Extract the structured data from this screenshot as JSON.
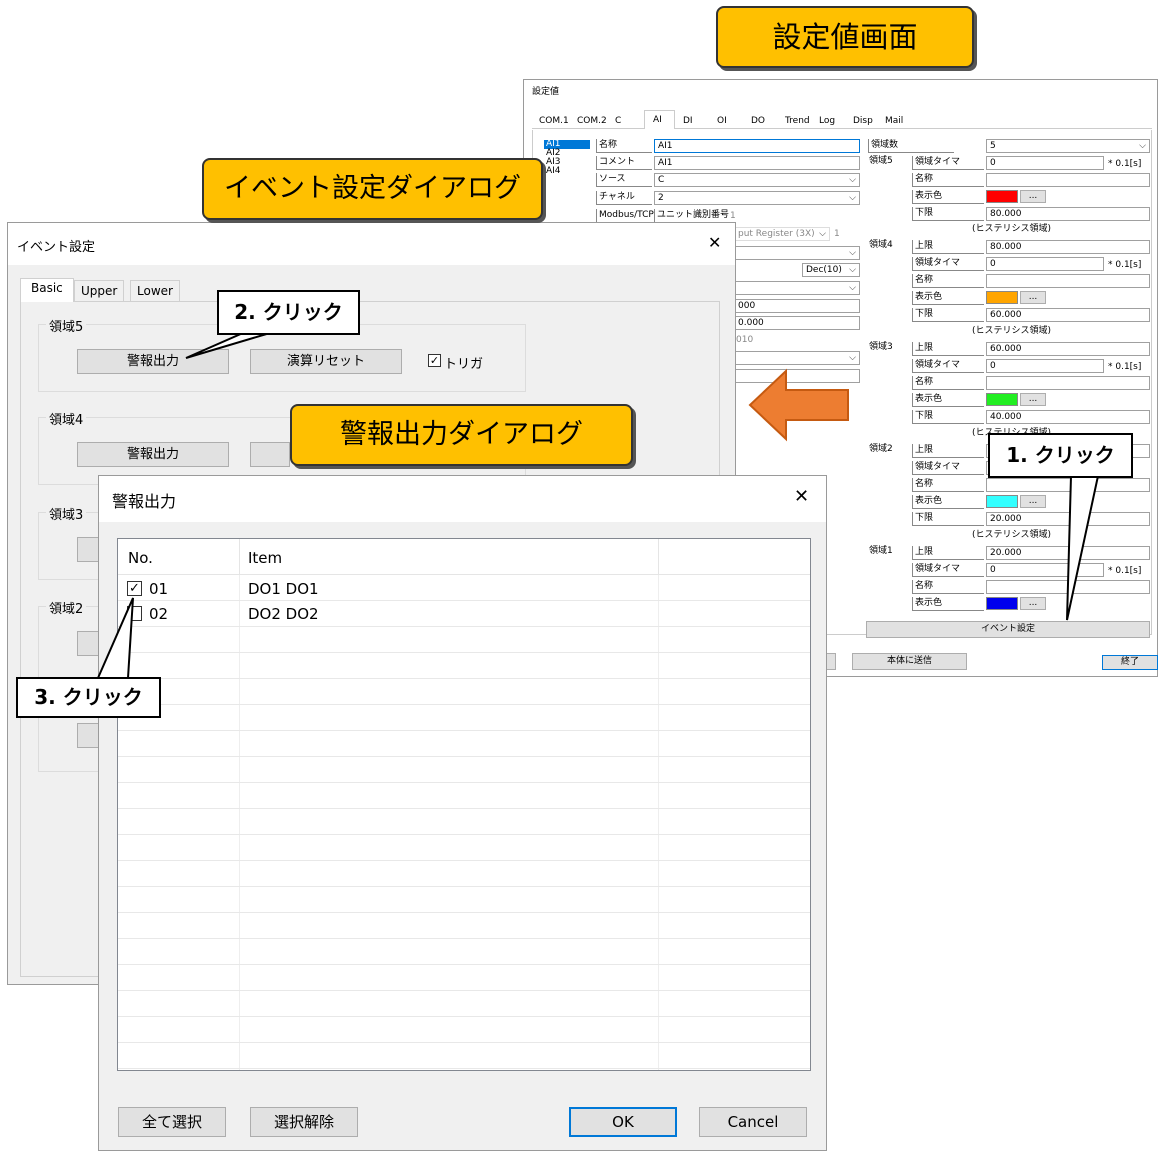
{
  "callouts": {
    "settings_screen": "設定値画面",
    "event_dialog": "イベント設定ダイアログ",
    "alarm_dialog": "警報出力ダイアログ",
    "step1": "1. クリック",
    "step2": "2. クリック",
    "step3": "3. クリック"
  },
  "settings": {
    "title": "設定値",
    "tabs": [
      "COM.1",
      "COM.2",
      "C",
      "AI",
      "DI",
      "OI",
      "DO",
      "Trend",
      "Log",
      "Disp",
      "Mail"
    ],
    "channels": [
      "AI1",
      "AI2",
      "AI3",
      "AI4"
    ],
    "fields": {
      "name_label": "名称",
      "name_value": "AI1",
      "comment_label": "コメント",
      "comment_value": "AI1",
      "source_label": "ソース",
      "source_value": "C",
      "channel_label": "チャネル",
      "channel_value": "2",
      "modbus_label": "Modbus/TCP",
      "unit_label": "ユニット識別番号",
      "unit_value": "1",
      "register_value": "put Register (3X)",
      "register_num": "1",
      "format_value": "Dec(10)",
      "val_a": "000",
      "val_b": "0.000",
      "val_c": "010"
    },
    "zone_count_label": "領域数",
    "zone_count_value": "5",
    "zones": {
      "zone5": {
        "label": "領域5",
        "timer_label": "領域タイマ",
        "timer_value": "0",
        "unit": "* 0.1[s]",
        "name_label": "名称",
        "color_label": "表示色",
        "color": "#ff0000",
        "lower_label": "下限",
        "lower_value": "80.000"
      },
      "hys1": "(ヒステリシス領域)",
      "zone4": {
        "label": "領域4",
        "upper_label": "上限",
        "upper_value": "80.000",
        "timer_label": "領域タイマ",
        "timer_value": "0",
        "unit": "* 0.1[s]",
        "name_label": "名称",
        "color_label": "表示色",
        "color": "#ffa500",
        "lower_label": "下限",
        "lower_value": "60.000"
      },
      "hys2": "(ヒステリシス領域)",
      "zone3": {
        "label": "領域3",
        "upper_label": "上限",
        "upper_value": "60.000",
        "timer_label": "領域タイマ",
        "timer_value": "0",
        "unit": "* 0.1[s]",
        "name_label": "名称",
        "color_label": "表示色",
        "color": "#22ee22",
        "lower_label": "下限",
        "lower_value": "40.000"
      },
      "hys3": "(ヒステリシス領域)",
      "zone2": {
        "label": "領域2",
        "upper_label": "上限",
        "timer_label": "領域タイマ",
        "name_label": "名称",
        "color_label": "表示色",
        "color": "#33ffff",
        "lower_label": "下限",
        "lower_value": "20.000"
      },
      "hys4": "(ヒステリシス領域)",
      "zone1": {
        "label": "領域1",
        "upper_label": "上限",
        "upper_value": "20.000",
        "timer_label": "領域タイマ",
        "timer_value": "0",
        "unit": "* 0.1[s]",
        "name_label": "名称",
        "color_label": "表示色",
        "color": "#0000ee"
      }
    },
    "ellipsis": "...",
    "event_button": "イベント設定",
    "send_button": "本体に送信",
    "exit_button": "終了"
  },
  "event_dialog": {
    "title": "イベント設定",
    "close": "✕",
    "tabs": [
      "Basic",
      "Upper",
      "Lower"
    ],
    "zones": [
      "領域5",
      "領域4",
      "領域3",
      "領域2"
    ],
    "alarm_button": "警報出力",
    "reset_button": "演算リセット",
    "trigger_label": "トリガ"
  },
  "alarm_dialog": {
    "title": "警報出力",
    "close": "✕",
    "columns": [
      "No.",
      "Item"
    ],
    "rows": [
      {
        "no": "01",
        "item": "DO1 DO1",
        "checked": true
      },
      {
        "no": "02",
        "item": "DO2 DO2",
        "checked": false
      }
    ],
    "select_all": "全て選択",
    "deselect": "選択解除",
    "ok": "OK",
    "cancel": "Cancel"
  }
}
